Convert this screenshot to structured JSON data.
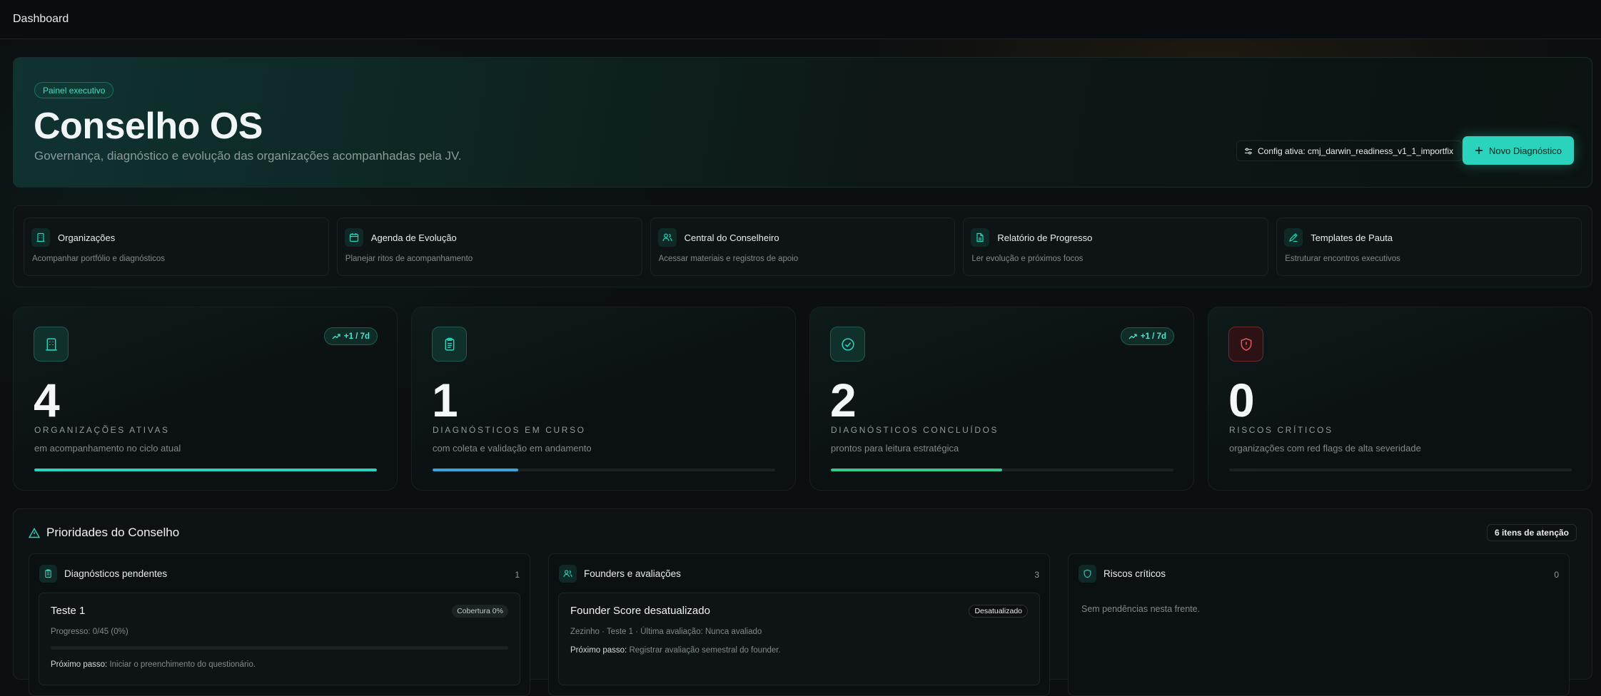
{
  "topbar": {
    "title": "Dashboard"
  },
  "hero": {
    "badge": "Painel executivo",
    "title": "Conselho OS",
    "subtitle": "Governança, diagnóstico e evolução das organizações acompanhadas pela JV.",
    "config_label": "Config ativa: cmj_darwin_readiness_v1_1_importfix",
    "new_button": "Novo Diagnóstico"
  },
  "quick_links": [
    {
      "title": "Organizações",
      "desc": "Acompanhar portfólio e diagnósticos",
      "icon": "building-icon"
    },
    {
      "title": "Agenda de Evolução",
      "desc": "Planejar ritos de acompanhamento",
      "icon": "calendar-icon"
    },
    {
      "title": "Central do Conselheiro",
      "desc": "Acessar materiais e registros de apoio",
      "icon": "users-icon"
    },
    {
      "title": "Relatório de Progresso",
      "desc": "Ler evolução e próximos focos",
      "icon": "file-icon"
    },
    {
      "title": "Templates de Pauta",
      "desc": "Estruturar encontros executivos",
      "icon": "template-icon"
    }
  ],
  "stats": [
    {
      "value": "4",
      "label": "ORGANIZAÇÕES ATIVAS",
      "desc": "em acompanhamento no ciclo atual",
      "trend": "+1 / 7d",
      "progress": 1.0,
      "color": "#2ad3bb",
      "icon": "building-icon"
    },
    {
      "value": "1",
      "label": "DIAGNÓSTICOS EM CURSO",
      "desc": "com coleta e validação em andamento",
      "trend": "",
      "progress": 0.25,
      "color": "#3aa6d6",
      "icon": "clipboard-icon"
    },
    {
      "value": "2",
      "label": "DIAGNÓSTICOS CONCLUÍDOS",
      "desc": "prontos para leitura estratégica",
      "trend": "+1 / 7d",
      "progress": 0.5,
      "color": "#35c98a",
      "icon": "check-circle-icon"
    },
    {
      "value": "0",
      "label": "RISCOS CRÍTICOS",
      "desc": "organizações com red flags de alta severidade",
      "trend": "",
      "progress": 0,
      "color": "#e0555b",
      "icon": "shield-icon"
    }
  ],
  "priorities": {
    "title": "Prioridades do Conselho",
    "badge": "6 itens de atenção",
    "columns": [
      {
        "title": "Diagnósticos pendentes",
        "count": "1",
        "item": {
          "title": "Teste 1",
          "badge": "Cobertura 0%",
          "line1": "Progresso: 0/45 (0%)",
          "next_label": "Próximo passo:",
          "next_text": "Iniciar o preenchimento do questionário.",
          "progress": 0
        }
      },
      {
        "title": "Founders e avaliações",
        "count": "3",
        "item": {
          "title": "Founder Score desatualizado",
          "badge": "Desatualizado",
          "line1": "Zezinho · Teste 1 · Última avaliação: Nunca avaliado",
          "next_label": "Próximo passo:",
          "next_text": "Registrar avaliação semestral do founder."
        }
      },
      {
        "title": "Riscos críticos",
        "count": "0",
        "empty": "Sem pendências nesta frente."
      }
    ]
  }
}
